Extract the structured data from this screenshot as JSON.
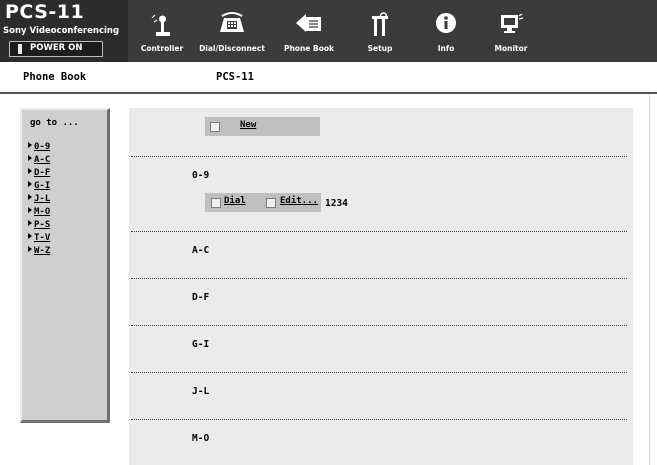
{
  "brand": {
    "title": "PCS-11",
    "subtitle": "Sony Videoconferencing",
    "power_label": "POWER ON"
  },
  "nav": [
    {
      "label": "Controller",
      "icon": "joystick-icon"
    },
    {
      "label": "Dial/Disconnect",
      "icon": "dial-disconnect-icon"
    },
    {
      "label": "Phone Book",
      "icon": "phone-book-icon"
    },
    {
      "label": "Setup",
      "icon": "setup-tools-icon"
    },
    {
      "label": "Info",
      "icon": "info-icon"
    },
    {
      "label": "Monitor",
      "icon": "monitor-icon"
    }
  ],
  "header": {
    "page_title": "Phone Book",
    "device_name": "PCS-11"
  },
  "goto": {
    "heading": "go to ...",
    "links": [
      "0-9",
      "A-C",
      "D-F",
      "G-I",
      "J-L",
      "M-O",
      "P-S",
      "T-V",
      "W-Z"
    ]
  },
  "main": {
    "new_button": "New",
    "dial_button": "Dial",
    "edit_button": "Edit...",
    "entry_number": "1234",
    "sections": [
      "0-9",
      "A-C",
      "D-F",
      "G-I",
      "J-L",
      "M-O"
    ]
  },
  "colors": {
    "header_bg": "#3b3b3b",
    "panel_bg": "#cfcfcf",
    "list_bg": "#ebebeb",
    "button_bg": "#bfbfbf"
  }
}
